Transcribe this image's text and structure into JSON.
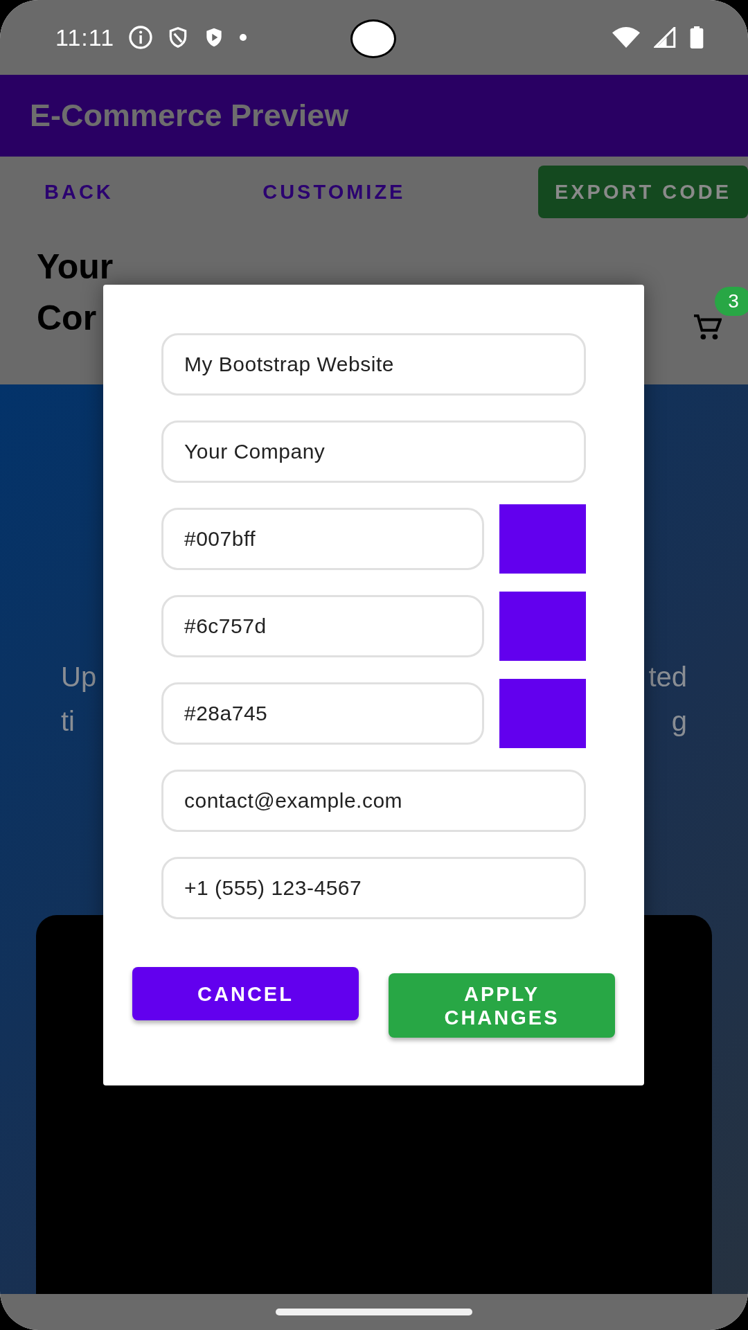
{
  "status_bar": {
    "time": "11:11"
  },
  "app_bar": {
    "title": "E-Commerce Preview"
  },
  "toolbar": {
    "buttons": [
      {
        "label": "BACK",
        "kind": "text"
      },
      {
        "label": "CUSTOMIZE",
        "kind": "text"
      },
      {
        "label": "EXPORT CODE",
        "kind": "filled"
      }
    ]
  },
  "header": {
    "title_lines": [
      "Your",
      "Cor"
    ],
    "cart_count": "3"
  },
  "hero": {
    "lines": [
      {
        "left": "Up",
        "right": "ted"
      },
      {
        "left": "ti",
        "right": "g"
      }
    ]
  },
  "dialog": {
    "fields": [
      {
        "kind": "text",
        "value": "My Bootstrap Website"
      },
      {
        "kind": "text",
        "value": "Your Company"
      },
      {
        "kind": "color",
        "value": "#007bff"
      },
      {
        "kind": "color",
        "value": "#6c757d"
      },
      {
        "kind": "color",
        "value": "#28a745"
      },
      {
        "kind": "text",
        "value": "contact@example.com"
      },
      {
        "kind": "text",
        "value": "+1 (555) 123-4567"
      }
    ],
    "buttons": [
      {
        "label": "CANCEL",
        "kind": "cancel"
      },
      {
        "label": "APPLY CHANGES",
        "kind": "apply"
      }
    ]
  }
}
